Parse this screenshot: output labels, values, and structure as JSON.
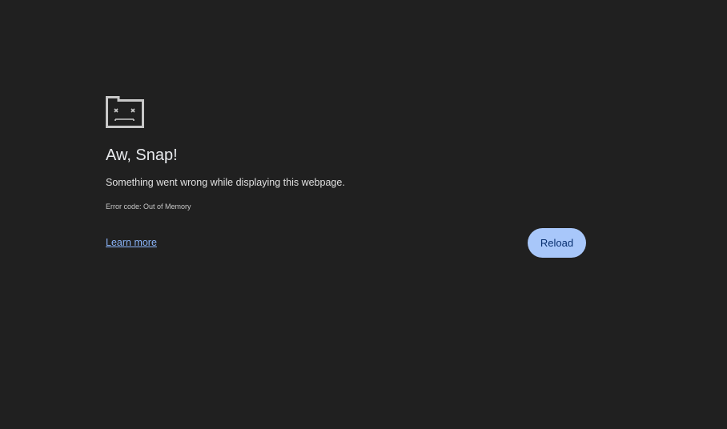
{
  "colors": {
    "background": "#202020",
    "title": "#e8eaed",
    "text": "#e0e0e0",
    "link": "#8ab4f8",
    "button_bg": "#a8c7fa",
    "button_text": "#062e6f",
    "icon": "#c8c8c8"
  },
  "error": {
    "icon": "sad-tab-icon",
    "title": "Aw, Snap!",
    "message": "Something went wrong while displaying this webpage.",
    "error_code": "Error code: Out of Memory",
    "learn_more_label": "Learn more",
    "reload_label": "Reload"
  }
}
